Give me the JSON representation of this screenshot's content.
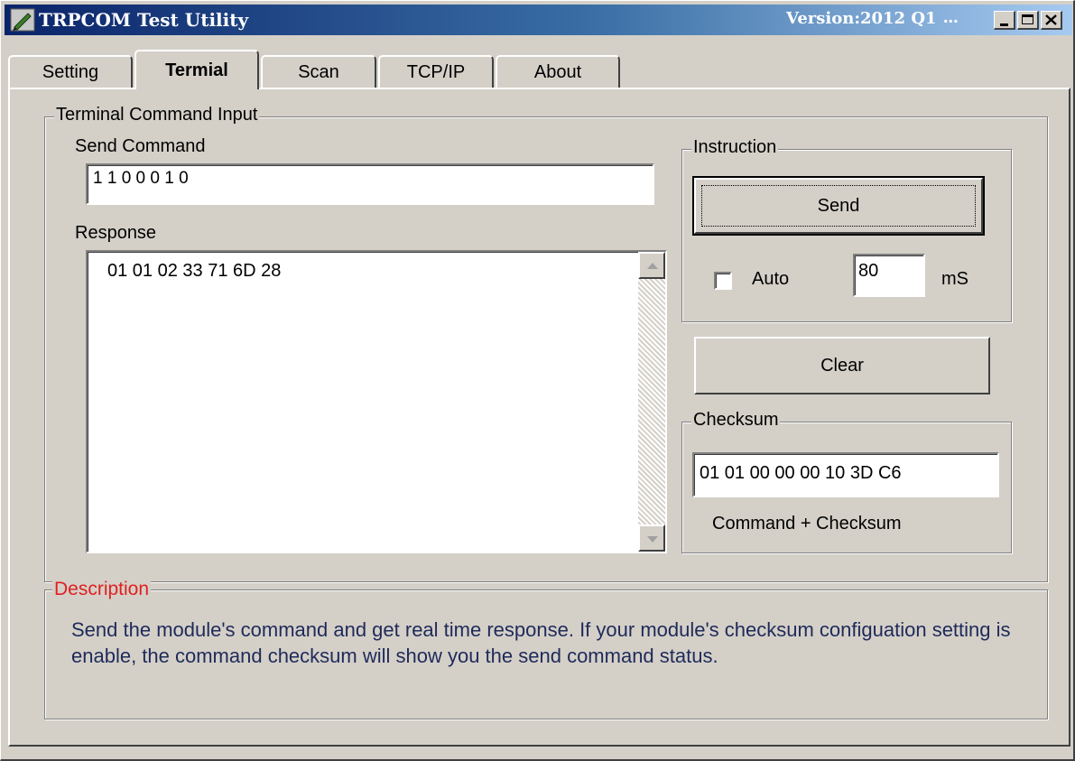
{
  "window": {
    "title": "TRPCOM Test Utility",
    "version": "Version:2012 Q1",
    "ellipsis": "...",
    "app_icon": "pen-tool-icon"
  },
  "tabs": [
    {
      "label": "Setting",
      "active": false
    },
    {
      "label": "Termial",
      "active": true
    },
    {
      "label": "Scan",
      "active": false
    },
    {
      "label": "TCP/IP",
      "active": false
    },
    {
      "label": "About",
      "active": false
    }
  ],
  "terminal": {
    "group_title": "Terminal Command Input",
    "send_label": "Send Command",
    "send_value": "1 1 0 0 0 1 0",
    "response_label": "Response",
    "response_value": "01 01 02 33 71 6D 28"
  },
  "instruction": {
    "group_title": "Instruction",
    "send_button": "Send",
    "auto_label": "Auto",
    "auto_checked": false,
    "interval_value": "80",
    "interval_unit": "mS"
  },
  "clear_button": "Clear",
  "checksum": {
    "group_title": "Checksum",
    "value": "01 01 00 00 00 10 3D C6",
    "caption": "Command + Checksum"
  },
  "description": {
    "title": "Description",
    "title_color": "#e02020",
    "text": "Send the module's command and get  real time response. If your module's checksum configuation setting is enable, the command checksum will show you the send command status."
  }
}
